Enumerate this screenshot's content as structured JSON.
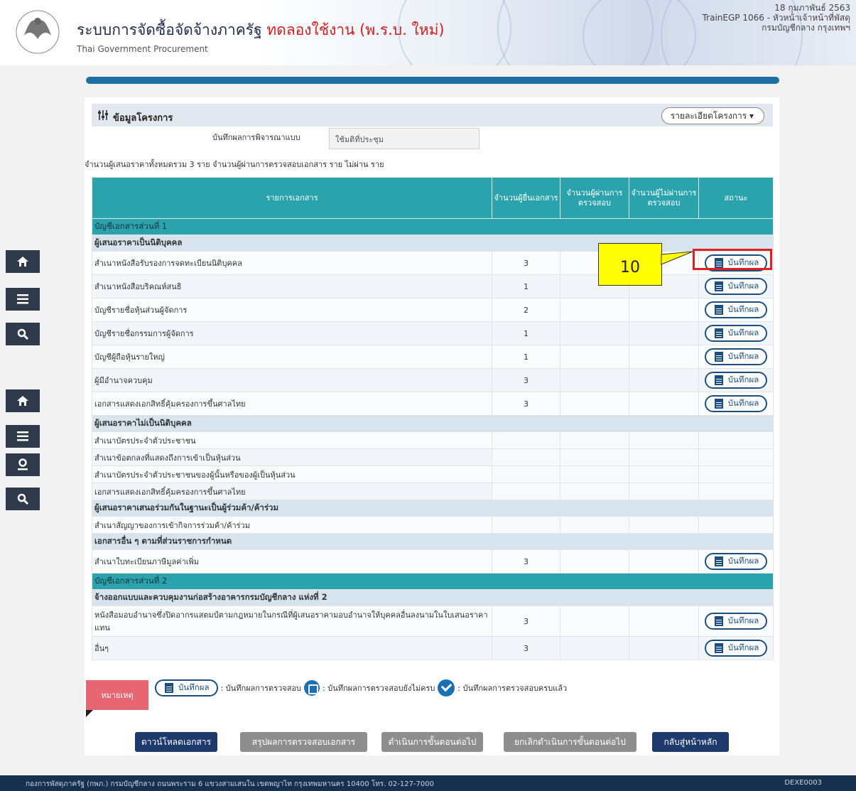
{
  "header": {
    "title_prefix": "ระบบการจัดซื้อจัดจ้างภาครัฐ",
    "title_trial": "ทดลองใช้งาน (พ.ร.บ. ใหม่)",
    "subtitle": "Thai Government Procurement",
    "date": "18 กุมภาพันธ์ 2563",
    "user": "TrainEGP 1066 - หัวหน้าเจ้าหน้าที่พัสดุ",
    "org": "กรมบัญชีกลาง กรุงเทพฯ"
  },
  "section": {
    "title": "ข้อมูลโครงการ",
    "detail_button": "รายละเอียดโครงการ",
    "consider_label": "บันทึกผลการพิจารณาแบบ",
    "consider_value": "ใช้มติที่ประชุม",
    "summary": "จำนวนผู้เสนอราคาทั้งหมดรวม 3 ราย จำนวนผู้ผ่านการตรวจสอบเอกสาร ราย ไม่ผ่าน ราย"
  },
  "table": {
    "headers": {
      "doc": "รายการเอกสาร",
      "count": "จำนวนผู้ยื่นเอกสาร",
      "pass": "จำนวนผู้ผ่านการตรวจสอบ",
      "fail": "จำนวนผู้ไม่ผ่านการตรวจสอบ",
      "status": "สถานะ"
    },
    "part1": "บัญชีเอกสารส่วนที่ 1",
    "group_juristic": "ผู้เสนอราคาเป็นนิติบุคคล",
    "juristic": [
      {
        "name": "สำเนาหนังสือรับรองการจดทะเบียนนิติบุคคล",
        "count": "3"
      },
      {
        "name": "สำเนาหนังสือบริคณห์สนธิ",
        "count": "1"
      },
      {
        "name": "บัญชีรายชื่อหุ้นส่วนผู้จัดการ",
        "count": "2"
      },
      {
        "name": "บัญชีรายชื่อกรรมการผู้จัดการ",
        "count": "1"
      },
      {
        "name": "บัญชีผู้ถือหุ้นรายใหญ่",
        "count": "1"
      },
      {
        "name": "ผู้มีอำนาจควบคุม",
        "count": "3"
      },
      {
        "name": "เอกสารแสดงเอกสิทธิ์คุ้มครองการขึ้นศาลไทย",
        "count": "3"
      }
    ],
    "group_nonjuristic": "ผู้เสนอราคาไม่เป็นนิติบุคคล",
    "nonjuristic": [
      "สำเนาบัตรประจำตัวประชาชน",
      "สำเนาข้อตกลงที่แสดงถึงการเข้าเป็นหุ้นส่วน",
      "สำเนาบัตรประจำตัวประชาชนของผู้นั้นหรือของผู้เป็นหุ้นส่วน",
      "เอกสารแสดงเอกสิทธิ์คุ้มครองการขึ้นศาลไทย"
    ],
    "group_joint": "ผู้เสนอราคาเสนอร่วมกันในฐานะเป็นผู้ร่วมค้า/ค้าร่วม",
    "joint": [
      "สำเนาสัญญาของการเข้ากิจการร่วมค้า/ค้าร่วม"
    ],
    "group_other": "เอกสารอื่น ๆ ตามที่ส่วนราชการกำหนด",
    "other": [
      {
        "name": "สำเนาใบทะเบียนภาษีมูลค่าเพิ่ม",
        "count": "3"
      }
    ],
    "part2": "บัญชีเอกสารส่วนที่ 2",
    "group_project": "จ้างออกแบบและควบคุมงานก่อสร้างอาคารกรมบัญชีกลาง แห่งที่ 2",
    "project": [
      {
        "name": "หนังสือมอบอำนาจซึ่งปิดอากรแสตมป์ตามกฎหมายในกรณีที่ผู้เสนอราคามอบอำนาจให้บุคคลอื่นลงนามในใบเสนอราคาแทน",
        "count": "3"
      },
      {
        "name": "อื่นๆ",
        "count": "3"
      }
    ],
    "save_label": "บันทึกผล"
  },
  "callout": {
    "number": "10"
  },
  "legend": {
    "note": "หมายเหตุ",
    "save_label": "บันทึกผล",
    "save_desc": ": บันทึกผลการตรวจสอบ",
    "incomplete_desc": ": บันทึกผลการตรวจสอบยังไม่ครบ",
    "complete_desc": ": บันทึกผลการตรวจสอบครบแล้ว"
  },
  "actions": {
    "download": "ดาวน์โหลดเอกสาร",
    "summary": "สรุปผลการตรวจสอบเอกสาร",
    "next": "ดำเนินการขั้นตอนต่อไป",
    "cancel_next": "ยกเลิกดำเนินการขั้นตอนต่อไป",
    "back": "กลับสู่หน้าหลัก"
  },
  "footer": {
    "address": "กองการพัสดุภาครัฐ (กพภ.) กรมบัญชีกลาง ถนนพระราม 6 แขวงสามเสนใน เขตพญาไท กรุงเทพมหานคร 10400 โทร. 02-127-7000",
    "code": "DEXE0003"
  },
  "colors": {
    "teal": "#2aa3ad",
    "navy": "#1e3a6c",
    "highlight": "#e02020",
    "callout": "#ffff00"
  }
}
